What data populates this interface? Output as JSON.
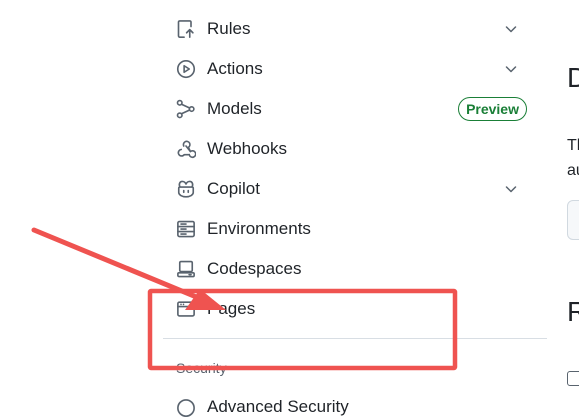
{
  "sidebar": {
    "items": [
      {
        "label": "Rules",
        "icon": "rules-icon",
        "chevron": true
      },
      {
        "label": "Actions",
        "icon": "play-icon",
        "chevron": true
      },
      {
        "label": "Models",
        "icon": "models-icon",
        "badge": "Preview"
      },
      {
        "label": "Webhooks",
        "icon": "webhook-icon"
      },
      {
        "label": "Copilot",
        "icon": "copilot-icon",
        "chevron": true
      },
      {
        "label": "Environments",
        "icon": "server-icon"
      },
      {
        "label": "Codespaces",
        "icon": "codespaces-icon"
      },
      {
        "label": "Pages",
        "icon": "browser-icon"
      }
    ],
    "section_heading": "Security",
    "partial_item_label": "Advanced Security",
    "partial_item_icon": "shield-icon"
  },
  "main": {
    "heading_fragment": "D",
    "text_line_1": "Th",
    "text_line_2": "au",
    "heading_2_fragment": "R"
  },
  "annotation": {
    "color": "#ef5350",
    "shape": "arrow-and-rectangle",
    "target": "Pages"
  },
  "colors": {
    "text": "#1f2328",
    "muted": "#59636e",
    "badge_green": "#1a7f37",
    "divider": "#d8dee4"
  }
}
